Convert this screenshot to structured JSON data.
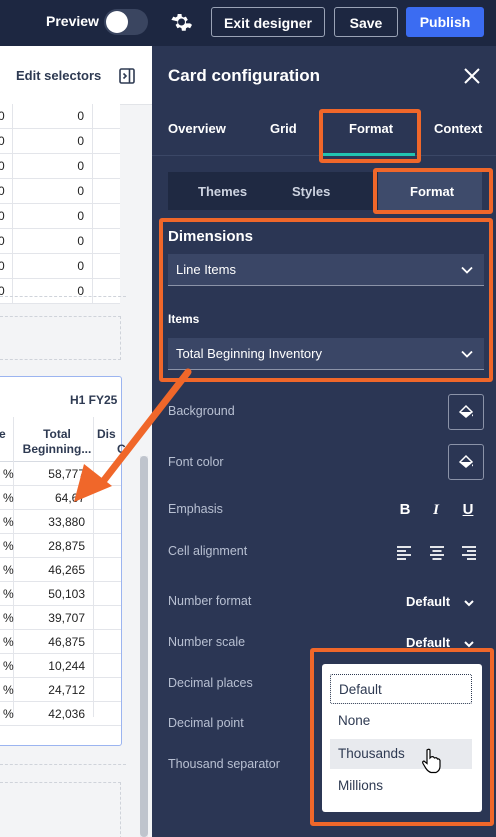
{
  "topbar": {
    "preview_label": "Preview",
    "exit_label": "Exit designer",
    "save_label": "Save",
    "publish_label": "Publish"
  },
  "canvas": {
    "edit_selectors_label": "Edit selectors",
    "grid1_rows": [
      {
        "left": "0",
        "right": "0"
      },
      {
        "left": "0",
        "right": "0"
      },
      {
        "left": "0",
        "right": "0"
      },
      {
        "left": "0",
        "right": "0"
      },
      {
        "left": "0",
        "right": "0"
      },
      {
        "left": "0",
        "right": "0"
      },
      {
        "left": "0",
        "right": "0"
      },
      {
        "left": "0",
        "right": "0"
      }
    ],
    "card2": {
      "period_header": "H1 FY25",
      "col_e": "e",
      "col_total_1": "Total",
      "col_total_2": "Beginning...",
      "col_dis_1": "Dis",
      "col_dis_2": "C",
      "rows": [
        {
          "pct": "%",
          "value": "58,777"
        },
        {
          "pct": "%",
          "value": "64,67"
        },
        {
          "pct": "%",
          "value": "33,880"
        },
        {
          "pct": "%",
          "value": "28,875"
        },
        {
          "pct": "%",
          "value": "46,265"
        },
        {
          "pct": "%",
          "value": "50,103"
        },
        {
          "pct": "%",
          "value": "39,707"
        },
        {
          "pct": "%",
          "value": "46,875"
        },
        {
          "pct": "%",
          "value": "10,244"
        },
        {
          "pct": "%",
          "value": "24,712"
        },
        {
          "pct": "%",
          "value": "42,036"
        }
      ]
    }
  },
  "panel": {
    "title": "Card configuration",
    "tabs": [
      "Overview",
      "Grid",
      "Format",
      "Context"
    ],
    "active_tab": "Format",
    "subtabs": [
      "Themes",
      "Styles",
      "Format"
    ],
    "active_subtab": "Format",
    "dimensions": {
      "title": "Dimensions",
      "dimension_value": "Line Items",
      "items_label": "Items",
      "items_value": "Total Beginning Inventory"
    },
    "properties": {
      "background": "Background",
      "font_color": "Font color",
      "emphasis": "Emphasis",
      "cell_alignment": "Cell alignment",
      "number_format": "Number format",
      "number_format_value": "Default",
      "number_scale": "Number scale",
      "number_scale_value": "Default",
      "decimal_places": "Decimal places",
      "decimal_point": "Decimal point",
      "thousand_separator": "Thousand separator"
    },
    "emphasis_icons": [
      "bold-icon",
      "italic-icon",
      "underline-icon"
    ],
    "alignment_icons": [
      "align-left-icon",
      "align-center-icon",
      "align-right-icon"
    ],
    "number_scale_dropdown": {
      "options": [
        "Default",
        "None",
        "Thousands",
        "Millions"
      ],
      "focused": "Default",
      "hovered": "Thousands"
    }
  },
  "colors": {
    "accent": "#3b6cf2",
    "highlight": "#f0672a",
    "tab_underline": "#22c4b0",
    "panel_bg": "#2b3654"
  }
}
